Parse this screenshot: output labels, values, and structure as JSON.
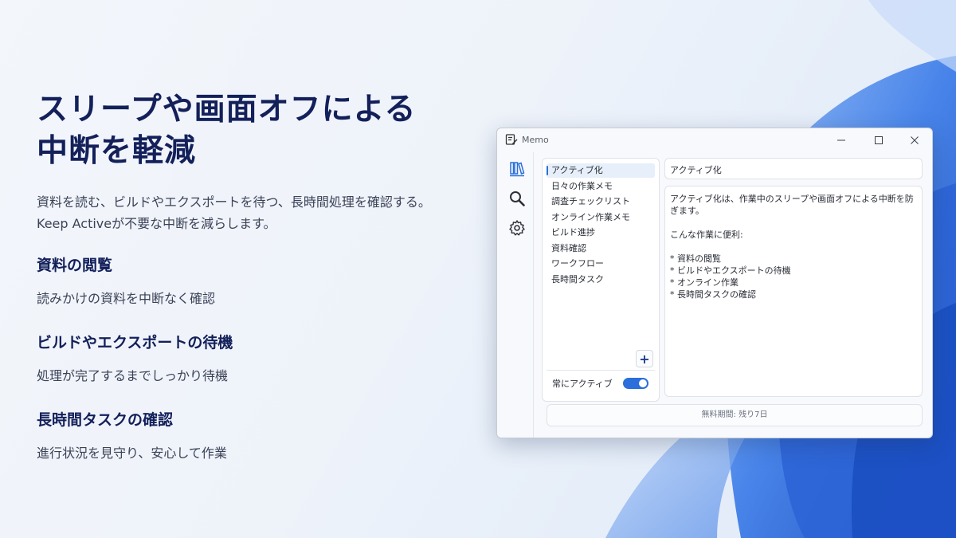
{
  "hero": {
    "title": "スリープや画面オフによる\n中断を軽減",
    "description": "資料を読む、ビルドやエクスポートを待つ、長時間処理を確認する。\nKeep Activeが不要な中断を減らします。"
  },
  "features": [
    {
      "title": "資料の閲覧",
      "text": "読みかけの資料を中断なく確認"
    },
    {
      "title": "ビルドやエクスポートの待機",
      "text": "処理が完了するまでしっかり待機"
    },
    {
      "title": "長時間タスクの確認",
      "text": "進行状況を見守り、安心して作業"
    }
  ],
  "window": {
    "title": "Memo",
    "icons": [
      "memo-app-icon",
      "minimize-icon",
      "maximize-icon",
      "close-icon"
    ],
    "rail_icons": [
      "books-icon",
      "search-icon",
      "gear-icon"
    ],
    "memo_list": [
      "アクティブ化",
      "日々の作業メモ",
      "調査チェックリスト",
      "オンライン作業メモ",
      "ビルド進捗",
      "資料確認",
      "ワークフロー",
      "長時間タスク"
    ],
    "selected_index": 0,
    "add_label": "+",
    "toggle_label": "常にアクティブ",
    "toggle_on": true,
    "memo_title": "アクティブ化",
    "memo_body": "アクティブ化は、作業中のスリープや画面オフによる中断を防ぎます。\n\nこんな作業に便利:\n\n* 資料の閲覧\n* ビルドやエクスポートの待機\n* オンライン作業\n* 長時間タスクの確認",
    "status": "無料期間: 残り7日"
  },
  "colors": {
    "accent": "#2a6fdb",
    "heading": "#13205a",
    "bloom": "#2f6de0"
  }
}
